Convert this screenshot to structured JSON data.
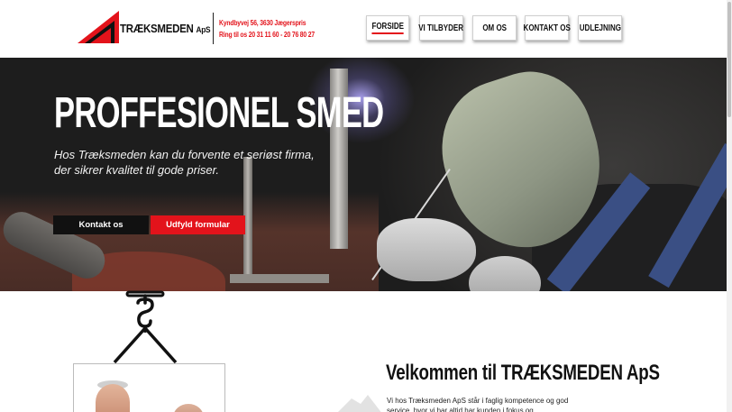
{
  "header": {
    "logo_text": "TRÆKSMEDEN",
    "logo_suffix": "ApS",
    "address": "Kyndbyvej 56, 3630 Jægerspris",
    "phone": "Ring til os 20 31 11 60 - 20 76 80 27"
  },
  "nav": {
    "items": [
      {
        "label": "FORSIDE",
        "active": true
      },
      {
        "label": "VI TILBYDER",
        "active": false
      },
      {
        "label": "OM OS",
        "active": false
      },
      {
        "label": "KONTAKT OS",
        "active": false
      },
      {
        "label": "UDLEJNING",
        "active": false
      }
    ]
  },
  "hero": {
    "title": "PROFFESIONEL SMED",
    "subtitle": "Hos Træksmeden kan du forvente et seriøst firma, der sikrer kvalitet til gode priser.",
    "btn_contact": "Kontakt os",
    "btn_form": "Udfyld formular"
  },
  "main": {
    "welcome_title": "Velkommen til TRÆKSMEDEN ApS",
    "intro_text": "Vi hos Træksmeden ApS står i faglig kompetence og god service, hvor vi har altid har kunden i fokus og"
  },
  "colors": {
    "accent": "#e3131b",
    "dark": "#111111"
  }
}
